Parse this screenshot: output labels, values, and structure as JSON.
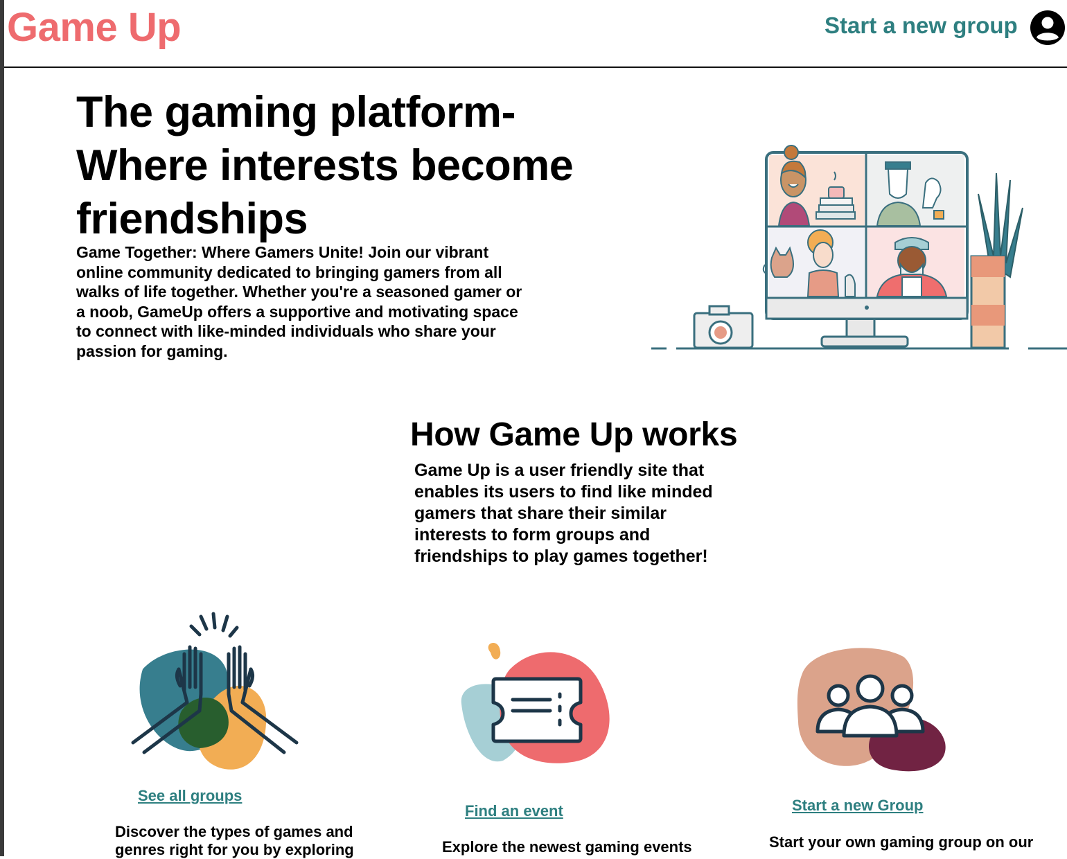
{
  "header": {
    "logo": "Game Up",
    "nav_link": "Start a new group",
    "avatar_icon": "user-circle-icon"
  },
  "hero": {
    "title_lines": [
      "The gaming platform-",
      "Where interests become",
      "friendships"
    ],
    "description": "Game Together: Where Gamers Unite! Join our vibrant online community dedicated to bringing gamers from all walks of life together. Whether you're a seasoned gamer or a noob, GameUp offers a supportive and motivating space to connect with like-minded individuals who share your passion for gaming.",
    "illustration": "video-call-illustration"
  },
  "how_it_works": {
    "title": "How Game Up works",
    "description": "Game Up is a user friendly site that enables its users to find like minded gamers that share their similar interests to form groups and friendships to play games together!"
  },
  "features": [
    {
      "icon": "high-five-icon",
      "link": "See all groups",
      "description": "Discover the types of games and genres right for you by exploring"
    },
    {
      "icon": "ticket-icon",
      "link": "Find an event",
      "description": "Explore the newest gaming events"
    },
    {
      "icon": "group-people-icon",
      "link": "Start a new Group",
      "description": "Start your own gaming group on our"
    }
  ],
  "colors": {
    "brand": "#ee6b6e",
    "accent": "#2e7f80",
    "teal_dark": "#377e8e",
    "teal_light": "#a6cfd5",
    "orange": "#f2ad54",
    "green_dark": "#285e2e",
    "salmon": "#dba38b",
    "maroon": "#712343",
    "navy": "#1d3648"
  }
}
